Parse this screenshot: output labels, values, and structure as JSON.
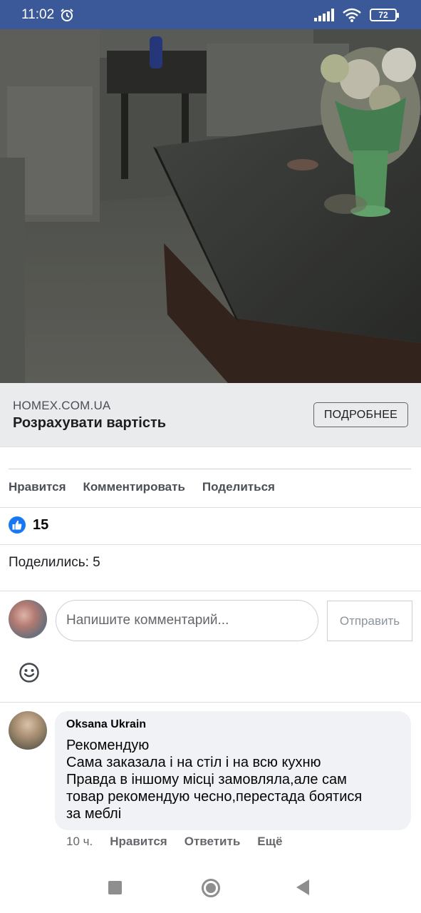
{
  "status_bar": {
    "time": "11:02",
    "battery": "72",
    "icons": [
      "alarm-icon",
      "signal-icon",
      "wifi-icon",
      "battery-icon"
    ]
  },
  "photo": {
    "description_icon": "living-room-photo"
  },
  "link_preview": {
    "domain": "HOMEX.COM.UA",
    "title": "Розрахувати вартість",
    "button_label": "ПОДРОБНЕЕ"
  },
  "actions": {
    "like": "Нравится",
    "comment": "Комментировать",
    "share": "Поделиться"
  },
  "reactions": {
    "count": "15",
    "icon": "thumbs-up-icon"
  },
  "shares": {
    "text": "Поделились: 5"
  },
  "composer": {
    "placeholder": "Напишите комментарий...",
    "send_label": "Отправить",
    "emoji_icon": "smiley-icon"
  },
  "comment": {
    "author": "Oksana Ukrain",
    "lines": [
      "Рекомендую",
      "Сама заказала і на стіл і на всю кухню",
      "Правда в іншому місці замовляла,але сам",
      "товар рекомендую чесно,перестада боятися",
      "за меблі"
    ],
    "time": "10 ч.",
    "like": "Нравится",
    "reply": "Ответить",
    "more": "Ещё"
  },
  "colors": {
    "status_bar_bg": "#3b5998",
    "link_preview_bg": "#eaebed",
    "like_blue": "#1877f2",
    "bubble_bg": "#f0f2f5"
  }
}
